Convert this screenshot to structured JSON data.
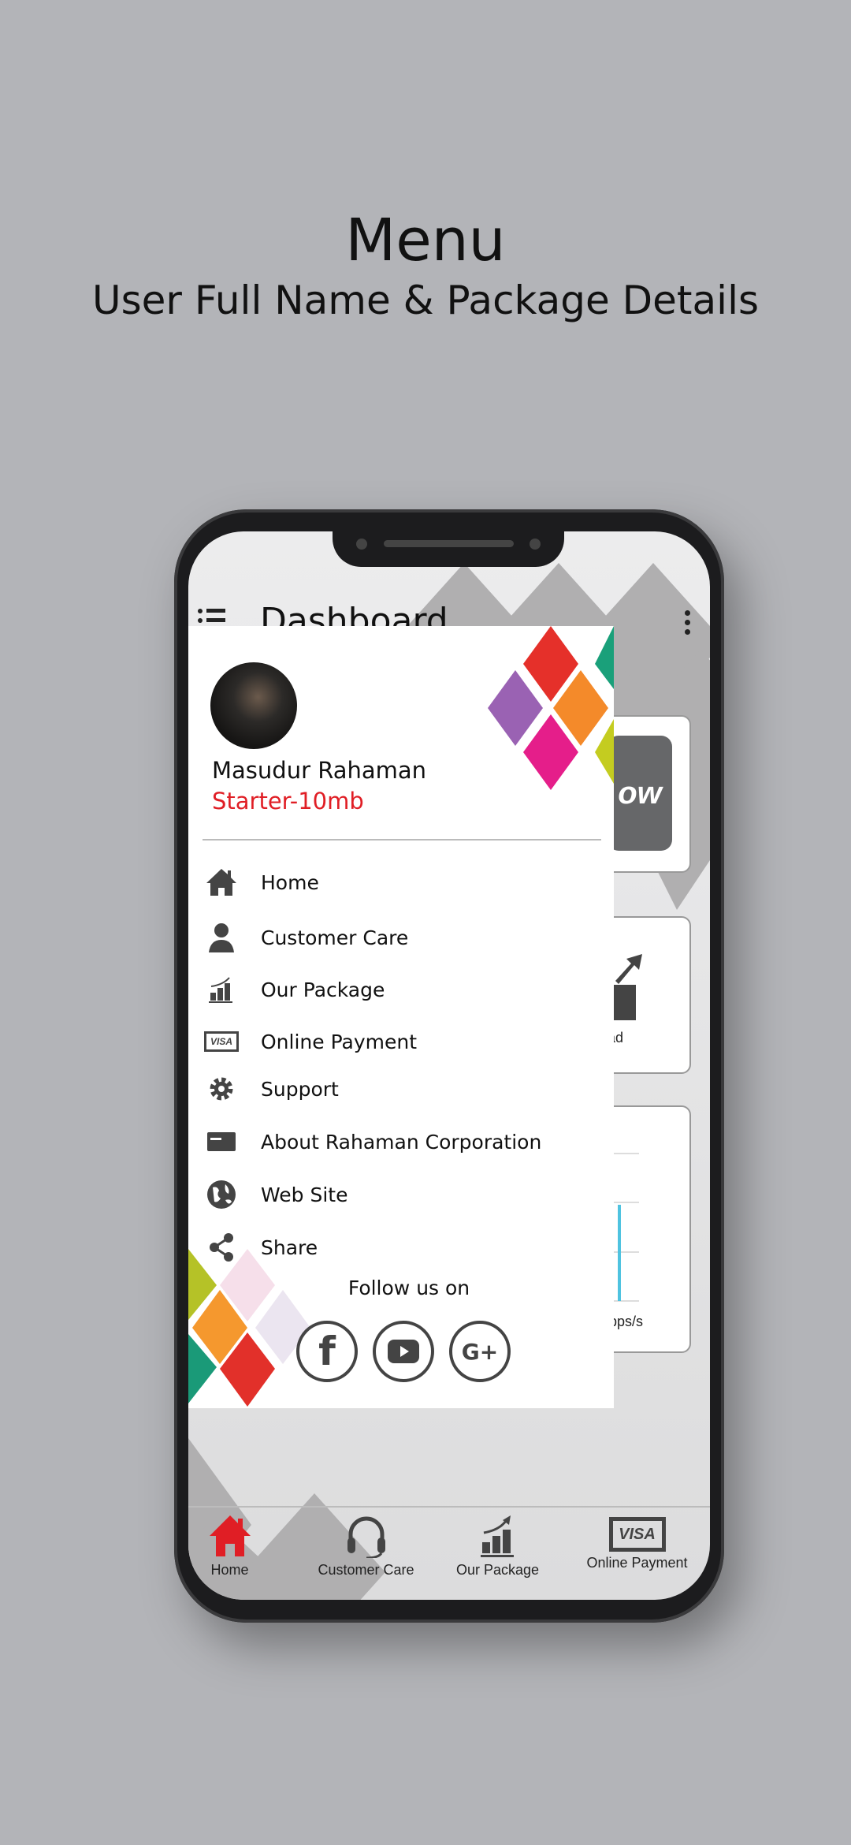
{
  "page": {
    "title": "Menu",
    "subtitle": "User Full Name & Package Details"
  },
  "app": {
    "header_title": "Dashboard",
    "card1_text": "ow",
    "card2_text": "ad",
    "card3_text": "Kbps/s"
  },
  "drawer": {
    "user_name": "Masudur Rahaman",
    "package": "Starter-10mb",
    "items": [
      {
        "label": "Home",
        "icon": "home-icon"
      },
      {
        "label": "Customer Care",
        "icon": "person-icon"
      },
      {
        "label": "Our Package",
        "icon": "chart-icon"
      },
      {
        "label": "Online Payment",
        "icon": "visa-icon"
      },
      {
        "label": "Support",
        "icon": "gear-icon"
      },
      {
        "label": "About Rahaman Corporation",
        "icon": "card-icon"
      },
      {
        "label": "Web Site",
        "icon": "globe-icon"
      },
      {
        "label": "Share",
        "icon": "share-icon"
      }
    ],
    "follow_label": "Follow us on",
    "social": [
      "facebook",
      "youtube",
      "google-plus"
    ]
  },
  "bottom_nav": [
    {
      "label": "Home",
      "active": true
    },
    {
      "label": "Customer Care"
    },
    {
      "label": "Our Package"
    },
    {
      "label": "Online Payment"
    }
  ],
  "colors": {
    "accent": "#e01e25",
    "background": "#b3b4b8",
    "chart_line": "#4fc3e0"
  }
}
